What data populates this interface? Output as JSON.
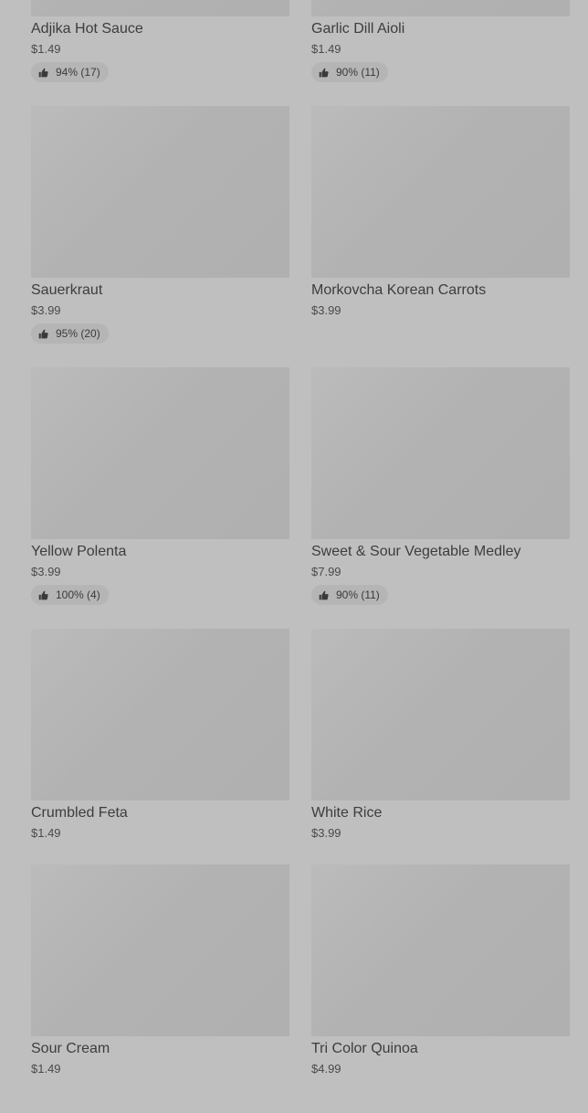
{
  "products": [
    {
      "name": "Adjika Hot Sauce",
      "price": "$1.49",
      "rating": "94% (17)"
    },
    {
      "name": "Garlic Dill Aioli",
      "price": "$1.49",
      "rating": "90% (11)"
    },
    {
      "name": "Sauerkraut",
      "price": "$3.99",
      "rating": "95% (20)"
    },
    {
      "name": "Morkovcha Korean Carrots",
      "price": "$3.99",
      "rating": null
    },
    {
      "name": "Yellow Polenta",
      "price": "$3.99",
      "rating": "100% (4)"
    },
    {
      "name": "Sweet & Sour Vegetable Medley",
      "price": "$7.99",
      "rating": "90% (11)"
    },
    {
      "name": "Crumbled Feta",
      "price": "$1.49",
      "rating": null
    },
    {
      "name": "White Rice",
      "price": "$3.99",
      "rating": null
    },
    {
      "name": "Sour Cream",
      "price": "$1.49",
      "rating": null
    },
    {
      "name": "Tri Color Quinoa",
      "price": "$4.99",
      "rating": null
    }
  ],
  "icons": {
    "rating": "thumbs-up-icon"
  },
  "colors": {
    "overlay_background": "#bfbfbf",
    "image_placeholder": "#b2b2b2",
    "rating_pill": "#b5b5b5",
    "text": "#3a3a3a"
  }
}
